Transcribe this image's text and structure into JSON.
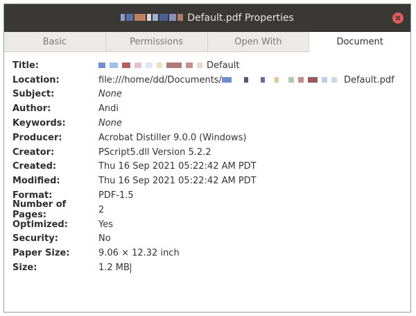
{
  "window": {
    "title_suffix": "Default.pdf Properties",
    "accent_close": "#e35c5c"
  },
  "tabs": [
    {
      "label": "Basic",
      "active": false
    },
    {
      "label": "Permissions",
      "active": false
    },
    {
      "label": "Open With",
      "active": false
    },
    {
      "label": "Document",
      "active": true
    }
  ],
  "properties": {
    "title": {
      "label": "Title:",
      "value": "Default"
    },
    "location": {
      "label": "Location:",
      "value_prefix": "file:///home/dd/Documents/",
      "value_suffix": "Default.pdf"
    },
    "subject": {
      "label": "Subject:",
      "value": "None"
    },
    "author": {
      "label": "Author:",
      "value": "Andi"
    },
    "keywords": {
      "label": "Keywords:",
      "value": "None"
    },
    "producer": {
      "label": "Producer:",
      "value": "Acrobat Distiller 9.0.0 (Windows)"
    },
    "creator": {
      "label": "Creator:",
      "value": "PScript5.dll Version 5.2.2"
    },
    "created": {
      "label": "Created:",
      "value": "Thu 16 Sep 2021 05:22:42 AM PDT"
    },
    "modified": {
      "label": "Modified:",
      "value": "Thu 16 Sep 2021 05:22:42 AM PDT"
    },
    "format": {
      "label": "Format:",
      "value": "PDF-1.5"
    },
    "pages": {
      "label": "Number of Pages:",
      "value": "2"
    },
    "optimized": {
      "label": "Optimized:",
      "value": "Yes"
    },
    "security": {
      "label": "Security:",
      "value": "No"
    },
    "paper_size": {
      "label": "Paper Size:",
      "value": "9.06 × 12.32 inch"
    },
    "size": {
      "label": "Size:",
      "value": "1.2 MB"
    }
  }
}
